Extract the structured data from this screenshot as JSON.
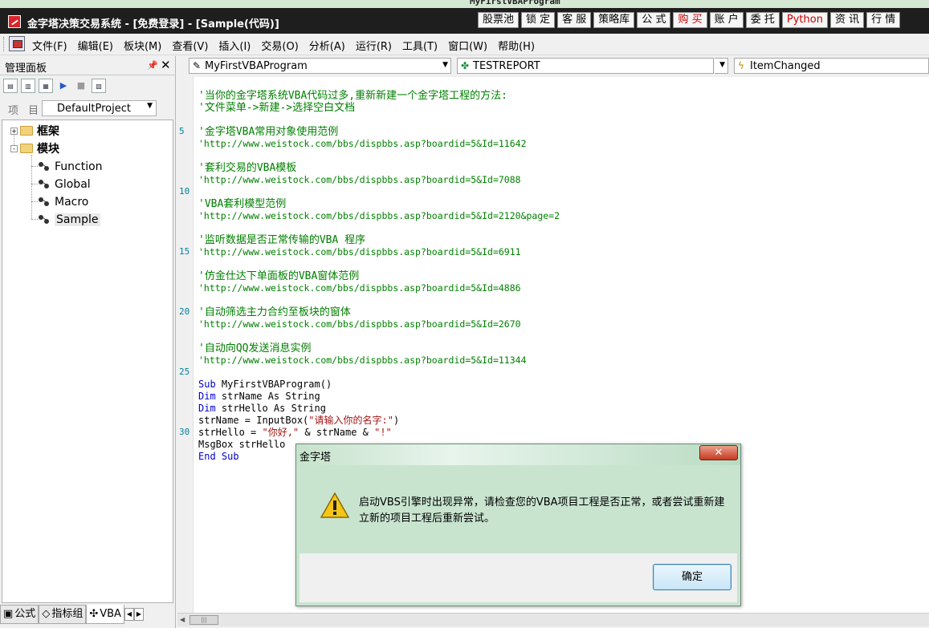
{
  "window": {
    "background_title_text": "MyFirstVBAProgram",
    "title": "金字塔决策交易系统 - [免费登录] - [Sample(代码)]",
    "title_buttons": [
      {
        "label": "股票池",
        "color": "#000000"
      },
      {
        "label": "锁 定",
        "color": "#000000"
      },
      {
        "label": "客 服",
        "color": "#000000"
      },
      {
        "label": "策略库",
        "color": "#000000"
      },
      {
        "label": "公 式",
        "color": "#000000"
      },
      {
        "label": "购 买",
        "color": "#cc0000"
      },
      {
        "label": "账 户",
        "color": "#000000"
      },
      {
        "label": "委 托",
        "color": "#000000"
      },
      {
        "label": "Python",
        "color": "#cc0000"
      },
      {
        "label": "资 讯",
        "color": "#000000"
      },
      {
        "label": "行 情",
        "color": "#000000"
      }
    ]
  },
  "menu": {
    "items": [
      "文件(F)",
      "编辑(E)",
      "板块(M)",
      "查看(V)",
      "插入(I)",
      "交易(O)",
      "分析(A)",
      "运行(R)",
      "工具(T)",
      "窗口(W)",
      "帮助(H)"
    ]
  },
  "left_panel": {
    "title": "管理面板",
    "pin_icon": "pin-icon",
    "close_icon": "close-icon",
    "project_label": "项 目",
    "project_value": "DefaultProject",
    "tree": {
      "folders": [
        {
          "label": "框架",
          "expander": "+"
        },
        {
          "label": "模块",
          "expander": "-"
        }
      ],
      "modules": [
        "Function",
        "Global",
        "Macro",
        "Sample"
      ]
    },
    "tabs": [
      {
        "label": "公式",
        "icon": "formula-icon"
      },
      {
        "label": "指标组",
        "icon": "indicator-group-icon"
      },
      {
        "label": "VBA",
        "icon": "vba-icon"
      }
    ]
  },
  "editor_toolbar": {
    "procedure_combo": "MyFirstVBAProgram",
    "object_combo": "TESTREPORT",
    "event_combo": "ItemChanged"
  },
  "editor": {
    "line_numbers": [
      "5",
      "10",
      "15",
      "20",
      "25",
      "30"
    ],
    "comments": [
      "'当你的金字塔系统VBA代码过多,重新新建一个金字塔工程的方法:",
      "'文件菜单->新建->选择空白文档",
      "'金字塔VBA常用对象使用范例",
      "'http://www.weistock.com/bbs/dispbbs.asp?boardid=5&Id=11642",
      "'套利交易的VBA模板",
      "'http://www.weistock.com/bbs/dispbbs.asp?boardid=5&Id=7088",
      "'VBA套利模型范例",
      "'http://www.weistock.com/bbs/dispbbs.asp?boardid=5&Id=2120&page=2",
      "'监听数据是否正常传输的VBA 程序",
      "'http://www.weistock.com/bbs/dispbbs.asp?boardid=5&Id=6911",
      "'仿金仕达下单面板的VBA窗体范例",
      "'http://www.weistock.com/bbs/dispbbs.asp?boardid=5&Id=4886",
      "'自动筛选主力合约至板块的窗体",
      "'http://www.weistock.com/bbs/dispbbs.asp?boardid=5&Id=2670",
      "'自动向QQ发送消息实例",
      "'http://www.weistock.com/bbs/dispbbs.asp?boardid=5&Id=11344"
    ],
    "code": {
      "l1_kw": "Sub",
      "l1_tx": " MyFirstVBAProgram()",
      "l2_kw": "Dim",
      "l2_tx": " strName As String",
      "l3_kw": "Dim",
      "l3_tx": " strHello As String",
      "l4_tx": "strName = InputBox(",
      "l4_st": "\"请输入你的名字:\"",
      "l4_tx2": ")",
      "l5_tx": "strHello = ",
      "l5_st": "\"你好,\"",
      "l5_tx2": " & strName & ",
      "l5_st2": "\"!\"",
      "l6_tx": "MsgBox strHello",
      "l7_kw": "End Sub"
    }
  },
  "dialog": {
    "title": "金字塔",
    "close_label": "✕",
    "message": "启动VBS引擎时出现异常，请检查您的VBA项目工程是否正常，或者尝试重新建立新的项目工程后重新尝试。",
    "ok_label": "确定",
    "icon": "warning-icon"
  },
  "colors": {
    "comment": "#008000",
    "keyword": "#0000cc",
    "string": "#a31515",
    "line_number": "#0080a0",
    "title_bar": "#1e1e1e",
    "dialog_background": "#c8e4cf"
  }
}
